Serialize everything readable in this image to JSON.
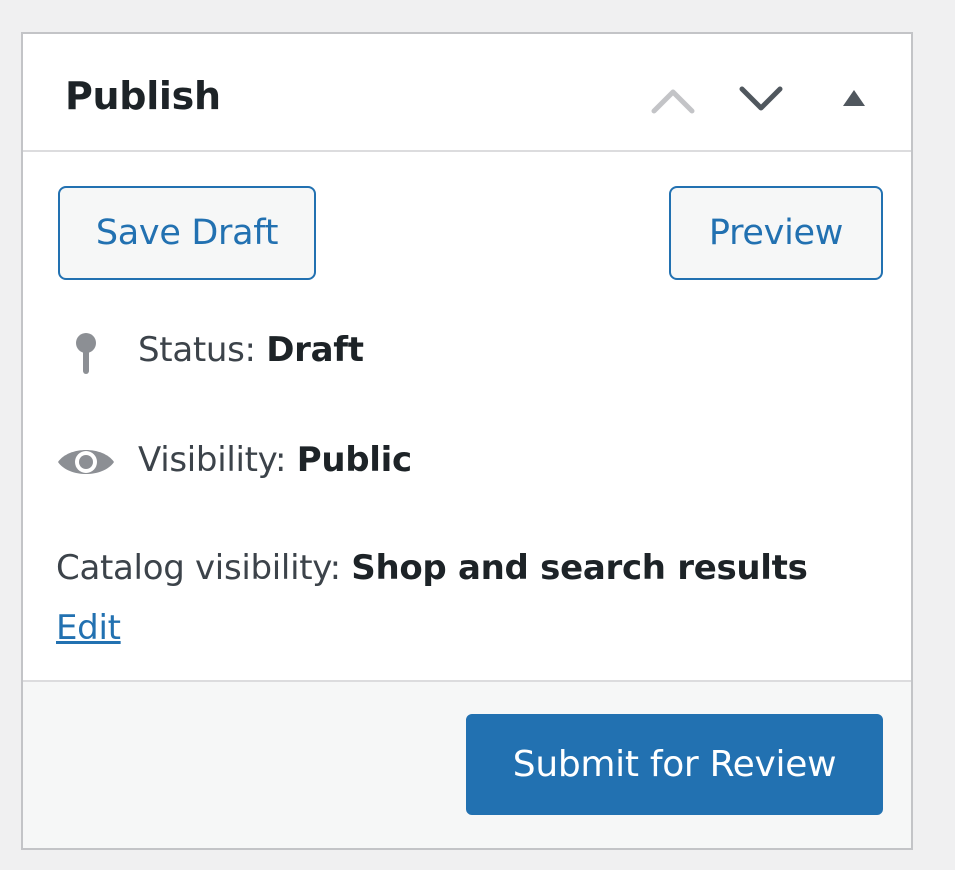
{
  "panel": {
    "title": "Publish",
    "header_buttons": {
      "move_up_icon": "chevron-up-icon",
      "move_down_icon": "chevron-down-icon",
      "toggle_icon": "triangle-up-icon"
    }
  },
  "actions": {
    "save_draft_label": "Save Draft",
    "preview_label": "Preview"
  },
  "status": {
    "icon": "pin-icon",
    "label": "Status:",
    "value": "Draft"
  },
  "visibility": {
    "icon": "eye-icon",
    "label": "Visibility:",
    "value": "Public"
  },
  "catalog_visibility": {
    "label": "Catalog visibility:",
    "value": "Shop and search results",
    "edit_link": "Edit"
  },
  "footer": {
    "submit_label": "Submit for Review"
  },
  "colors": {
    "primary": "#2271b1",
    "background": "#f0f0f1",
    "border": "#c3c4c7",
    "icon_gray": "#8c8f94"
  }
}
